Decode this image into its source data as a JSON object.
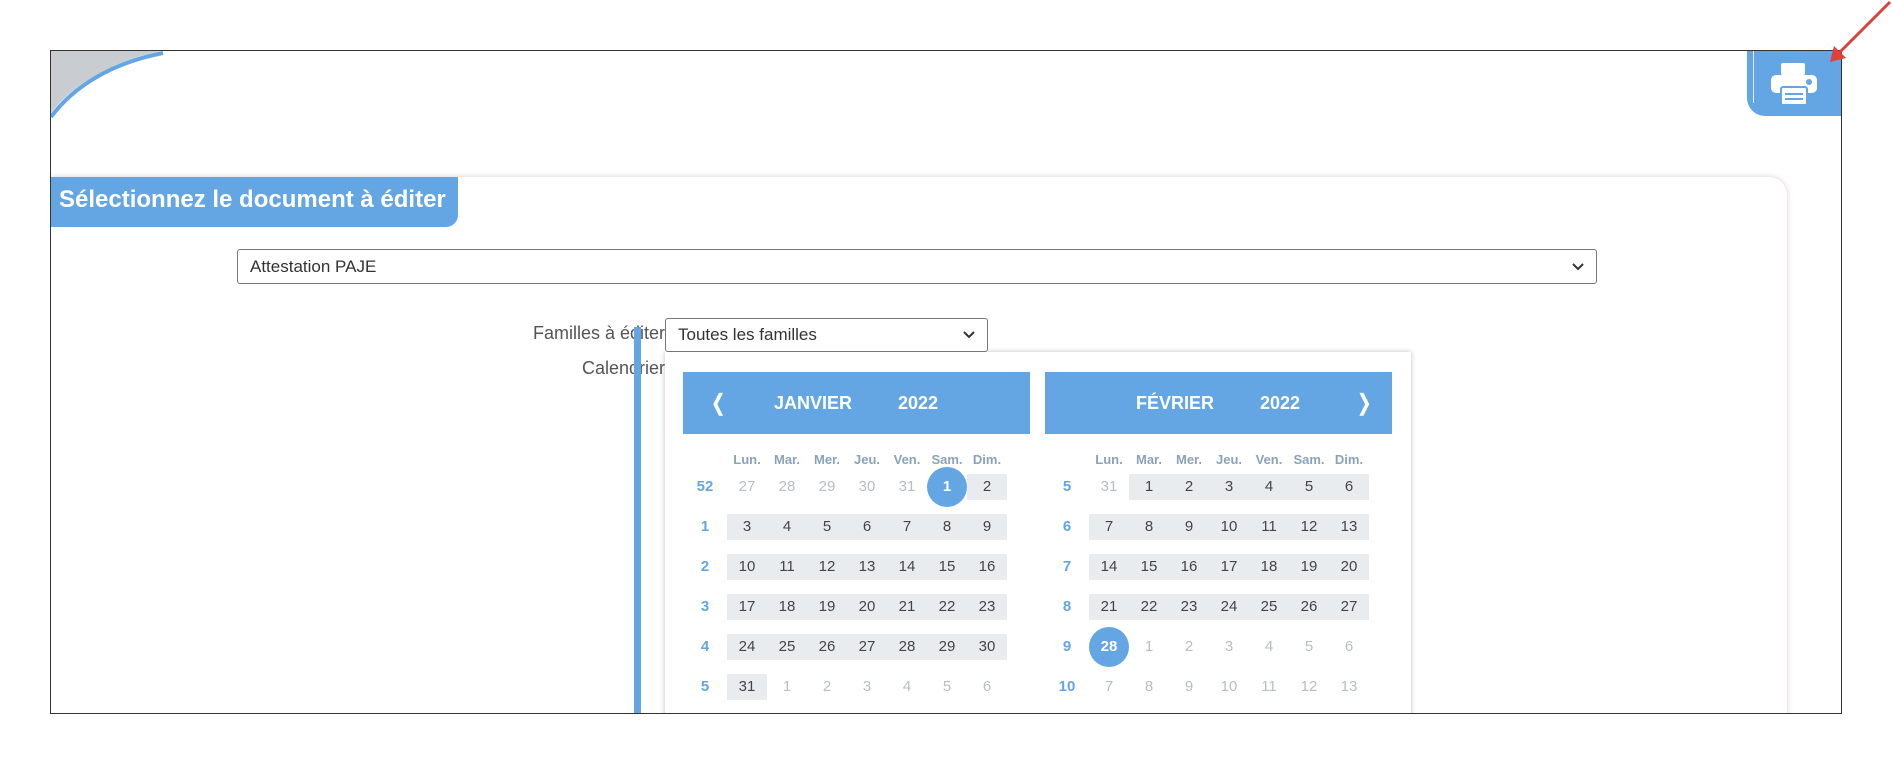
{
  "section": {
    "title": "Sélectionnez le document à éditer"
  },
  "document_select": {
    "value": "Attestation PAJE"
  },
  "form": {
    "families_label": "Familles à éditer",
    "families_value": "Toutes les familles",
    "calendar_label": "Calendrier"
  },
  "icons": {
    "print": "printer-icon",
    "chevron": "chevron-down-icon",
    "prev": "chevron-left-icon",
    "next": "chevron-right-icon"
  },
  "colors": {
    "accent": "#64a6e3",
    "day_bg": "#e9ecef",
    "muted": "#b9bec4"
  },
  "calendar": {
    "nav_prev": "❬",
    "nav_next": "❭",
    "weekdays": [
      "Lun.",
      "Mar.",
      "Mer.",
      "Jeu.",
      "Ven.",
      "Sam.",
      "Dim."
    ],
    "months": [
      {
        "name": "JANVIER",
        "year": "2022",
        "weeks": [
          {
            "num": "52",
            "days": [
              [
                "27",
                true
              ],
              [
                "28",
                true
              ],
              [
                "29",
                true
              ],
              [
                "30",
                true
              ],
              [
                "31",
                true
              ],
              [
                "1",
                false,
                true
              ],
              [
                "2",
                false
              ]
            ]
          },
          {
            "num": "1",
            "days": [
              [
                "3",
                false
              ],
              [
                "4",
                false
              ],
              [
                "5",
                false
              ],
              [
                "6",
                false
              ],
              [
                "7",
                false
              ],
              [
                "8",
                false
              ],
              [
                "9",
                false
              ]
            ]
          },
          {
            "num": "2",
            "days": [
              [
                "10",
                false
              ],
              [
                "11",
                false
              ],
              [
                "12",
                false
              ],
              [
                "13",
                false
              ],
              [
                "14",
                false
              ],
              [
                "15",
                false
              ],
              [
                "16",
                false
              ]
            ]
          },
          {
            "num": "3",
            "days": [
              [
                "17",
                false
              ],
              [
                "18",
                false
              ],
              [
                "19",
                false
              ],
              [
                "20",
                false
              ],
              [
                "21",
                false
              ],
              [
                "22",
                false
              ],
              [
                "23",
                false
              ]
            ]
          },
          {
            "num": "4",
            "days": [
              [
                "24",
                false
              ],
              [
                "25",
                false
              ],
              [
                "26",
                false
              ],
              [
                "27",
                false
              ],
              [
                "28",
                false
              ],
              [
                "29",
                false
              ],
              [
                "30",
                false
              ]
            ]
          },
          {
            "num": "5",
            "days": [
              [
                "31",
                false
              ],
              [
                "1",
                true
              ],
              [
                "2",
                true
              ],
              [
                "3",
                true
              ],
              [
                "4",
                true
              ],
              [
                "5",
                true
              ],
              [
                "6",
                true
              ]
            ]
          }
        ]
      },
      {
        "name": "FÉVRIER",
        "year": "2022",
        "weeks": [
          {
            "num": "5",
            "days": [
              [
                "31",
                true
              ],
              [
                "1",
                false
              ],
              [
                "2",
                false
              ],
              [
                "3",
                false
              ],
              [
                "4",
                false
              ],
              [
                "5",
                false
              ],
              [
                "6",
                false
              ]
            ]
          },
          {
            "num": "6",
            "days": [
              [
                "7",
                false
              ],
              [
                "8",
                false
              ],
              [
                "9",
                false
              ],
              [
                "10",
                false
              ],
              [
                "11",
                false
              ],
              [
                "12",
                false
              ],
              [
                "13",
                false
              ]
            ]
          },
          {
            "num": "7",
            "days": [
              [
                "14",
                false
              ],
              [
                "15",
                false
              ],
              [
                "16",
                false
              ],
              [
                "17",
                false
              ],
              [
                "18",
                false
              ],
              [
                "19",
                false
              ],
              [
                "20",
                false
              ]
            ]
          },
          {
            "num": "8",
            "days": [
              [
                "21",
                false
              ],
              [
                "22",
                false
              ],
              [
                "23",
                false
              ],
              [
                "24",
                false
              ],
              [
                "25",
                false
              ],
              [
                "26",
                false
              ],
              [
                "27",
                false
              ]
            ]
          },
          {
            "num": "9",
            "days": [
              [
                "28",
                false,
                true
              ],
              [
                "1",
                true
              ],
              [
                "2",
                true
              ],
              [
                "3",
                true
              ],
              [
                "4",
                true
              ],
              [
                "5",
                true
              ],
              [
                "6",
                true
              ]
            ]
          },
          {
            "num": "10",
            "days": [
              [
                "7",
                true
              ],
              [
                "8",
                true
              ],
              [
                "9",
                true
              ],
              [
                "10",
                true
              ],
              [
                "11",
                true
              ],
              [
                "12",
                true
              ],
              [
                "13",
                true
              ]
            ]
          }
        ]
      }
    ]
  }
}
